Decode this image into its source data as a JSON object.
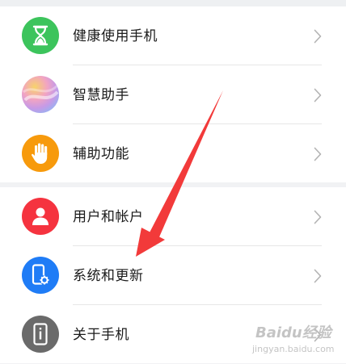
{
  "settings": {
    "group1": [
      {
        "label": "健康使用手机",
        "icon": "hourglass-icon",
        "color": "#3cc45c"
      },
      {
        "label": "智慧助手",
        "icon": "assistant-swirl-icon",
        "color": "#d59ae0"
      },
      {
        "label": "辅助功能",
        "icon": "hand-icon",
        "color": "#f79a0c"
      }
    ],
    "group2": [
      {
        "label": "用户和帐户",
        "icon": "user-icon",
        "color": "#f5333f"
      },
      {
        "label": "系统和更新",
        "icon": "phone-gear-icon",
        "color": "#1f7cf6"
      },
      {
        "label": "关于手机",
        "icon": "info-phone-icon",
        "color": "#6a6a6a"
      }
    ]
  },
  "annotation": {
    "arrow_color": "#f23a3a"
  },
  "watermark": {
    "brand": "Baidu经验",
    "url": "jingyan.baidu.com"
  }
}
